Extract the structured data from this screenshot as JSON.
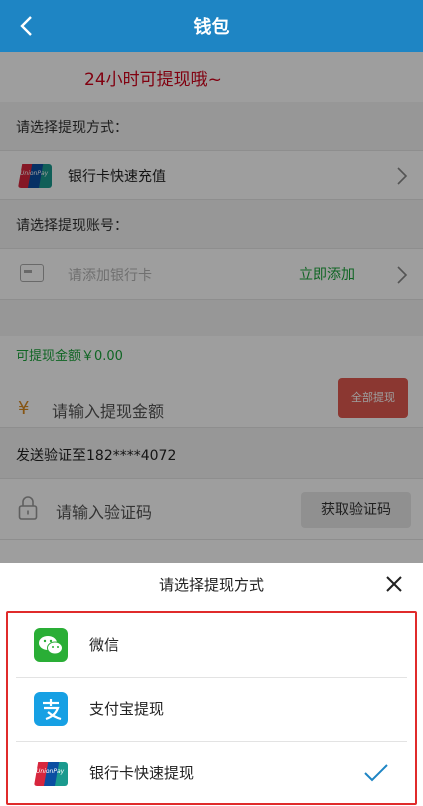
{
  "header": {
    "title": "钱包",
    "back_icon": "chevron-left-icon",
    "background": "#1E85C4"
  },
  "notice": {
    "text": "24小时可提现哦~",
    "color": "#d0021b"
  },
  "withdraw_method": {
    "label": "请选择提现方式：",
    "selected": "银行卡快速充值",
    "icon": "unionpay-icon"
  },
  "withdraw_account": {
    "label": "请选择提现账号：",
    "placeholder": "请添加银行卡",
    "action": "立即添加",
    "icon": "bank-card-icon"
  },
  "amount": {
    "available": "可提现金额￥0.00",
    "currency_symbol": "¥",
    "placeholder": "请输入提现金额",
    "withdraw_all_button": "全部提现"
  },
  "verify": {
    "send_to": "发送验证至182****4072",
    "placeholder": "请输入验证码",
    "get_code_button": "获取验证码",
    "icon": "lock-icon"
  },
  "sheet": {
    "title": "请选择提现方式",
    "close_icon": "close-icon",
    "options": [
      {
        "label": "微信",
        "icon": "wechat-icon",
        "selected": false
      },
      {
        "label": "支付宝提现",
        "icon": "alipay-icon",
        "selected": false
      },
      {
        "label": "银行卡快速提现",
        "icon": "unionpay-icon",
        "selected": true
      }
    ],
    "highlight_color": "#e02b2b"
  }
}
